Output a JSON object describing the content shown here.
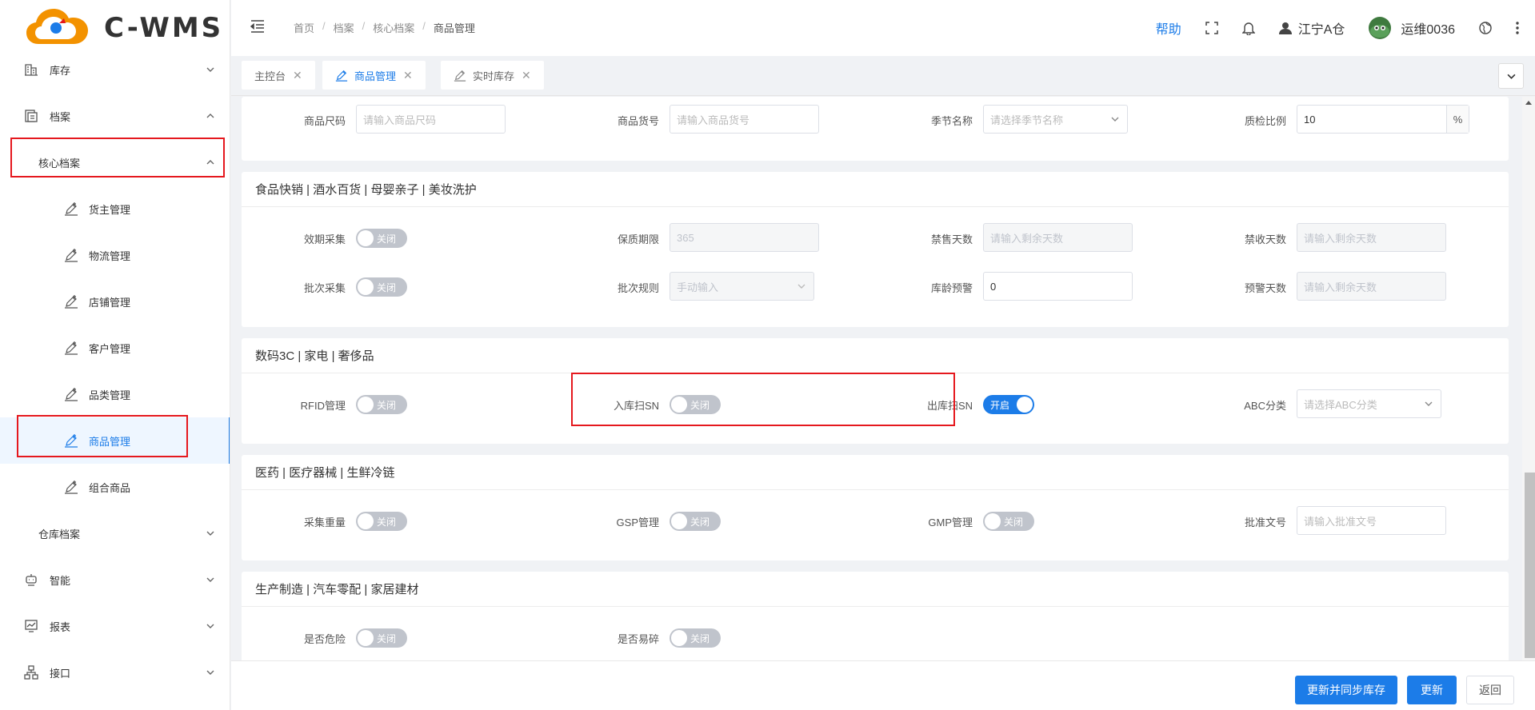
{
  "app": {
    "logo_text": "C-WMS"
  },
  "header": {
    "breadcrumb": [
      "首页",
      "档案",
      "核心档案",
      "商品管理"
    ],
    "help": "帮助",
    "warehouse": "江宁A仓",
    "username": "运维0036"
  },
  "sidebar": {
    "stock": "库存",
    "archive": "档案",
    "core_archive": "核心档案",
    "owner": "货主管理",
    "logistics": "物流管理",
    "shop": "店铺管理",
    "customer": "客户管理",
    "category": "品类管理",
    "goods": "商品管理",
    "combo": "组合商品",
    "warehouse_archive": "仓库档案",
    "smart": "智能",
    "report": "报表",
    "api": "接口"
  },
  "tabs": [
    "主控台",
    "商品管理",
    "实时库存"
  ],
  "form": {
    "top": {
      "size_label": "商品尺码",
      "size_ph": "请输入商品尺码",
      "code_label": "商品货号",
      "code_ph": "请输入商品货号",
      "season_label": "季节名称",
      "season_ph": "请选择季节名称",
      "qc_label": "质检比例",
      "qc_value": "10",
      "qc_unit": "%"
    },
    "food": {
      "title": "食品快销 | 酒水百货 | 母婴亲子 | 美妆洗护",
      "expiry_label": "效期采集",
      "expiry_state": "关闭",
      "shelf_label": "保质期限",
      "shelf_value": "365",
      "nosale_label": "禁售天数",
      "nosale_ph": "请输入剩余天数",
      "noreceive_label": "禁收天数",
      "noreceive_ph": "请输入剩余天数",
      "batch_label": "批次采集",
      "batch_state": "关闭",
      "batchrule_label": "批次规则",
      "batchrule_value": "手动输入",
      "agewarn_label": "库龄预警",
      "agewarn_value": "0",
      "warndays_label": "预警天数",
      "warndays_ph": "请输入剩余天数"
    },
    "digital": {
      "title": "数码3C | 家电 | 奢侈品",
      "rfid_label": "RFID管理",
      "rfid_state": "关闭",
      "insn_label": "入库扫SN",
      "insn_state": "关闭",
      "outsn_label": "出库扫SN",
      "outsn_state": "开启",
      "abc_label": "ABC分类",
      "abc_ph": "请选择ABC分类"
    },
    "medical": {
      "title": "医药 | 医疗器械 | 生鲜冷链",
      "weight_label": "采集重量",
      "weight_state": "关闭",
      "gsp_label": "GSP管理",
      "gsp_state": "关闭",
      "gmp_label": "GMP管理",
      "gmp_state": "关闭",
      "approval_label": "批准文号",
      "approval_ph": "请输入批准文号"
    },
    "mfg": {
      "title": "生产制造 | 汽车零配 | 家居建材",
      "danger_label": "是否危险",
      "danger_state": "关闭",
      "fragile_label": "是否易碎",
      "fragile_state": "关闭"
    }
  },
  "footer": {
    "sync_update": "更新并同步库存",
    "update": "更新",
    "back": "返回"
  },
  "colors": {
    "primary": "#1c7ce8",
    "highlight_box": "#e5181e",
    "switch_off": "#c0c4cc"
  }
}
